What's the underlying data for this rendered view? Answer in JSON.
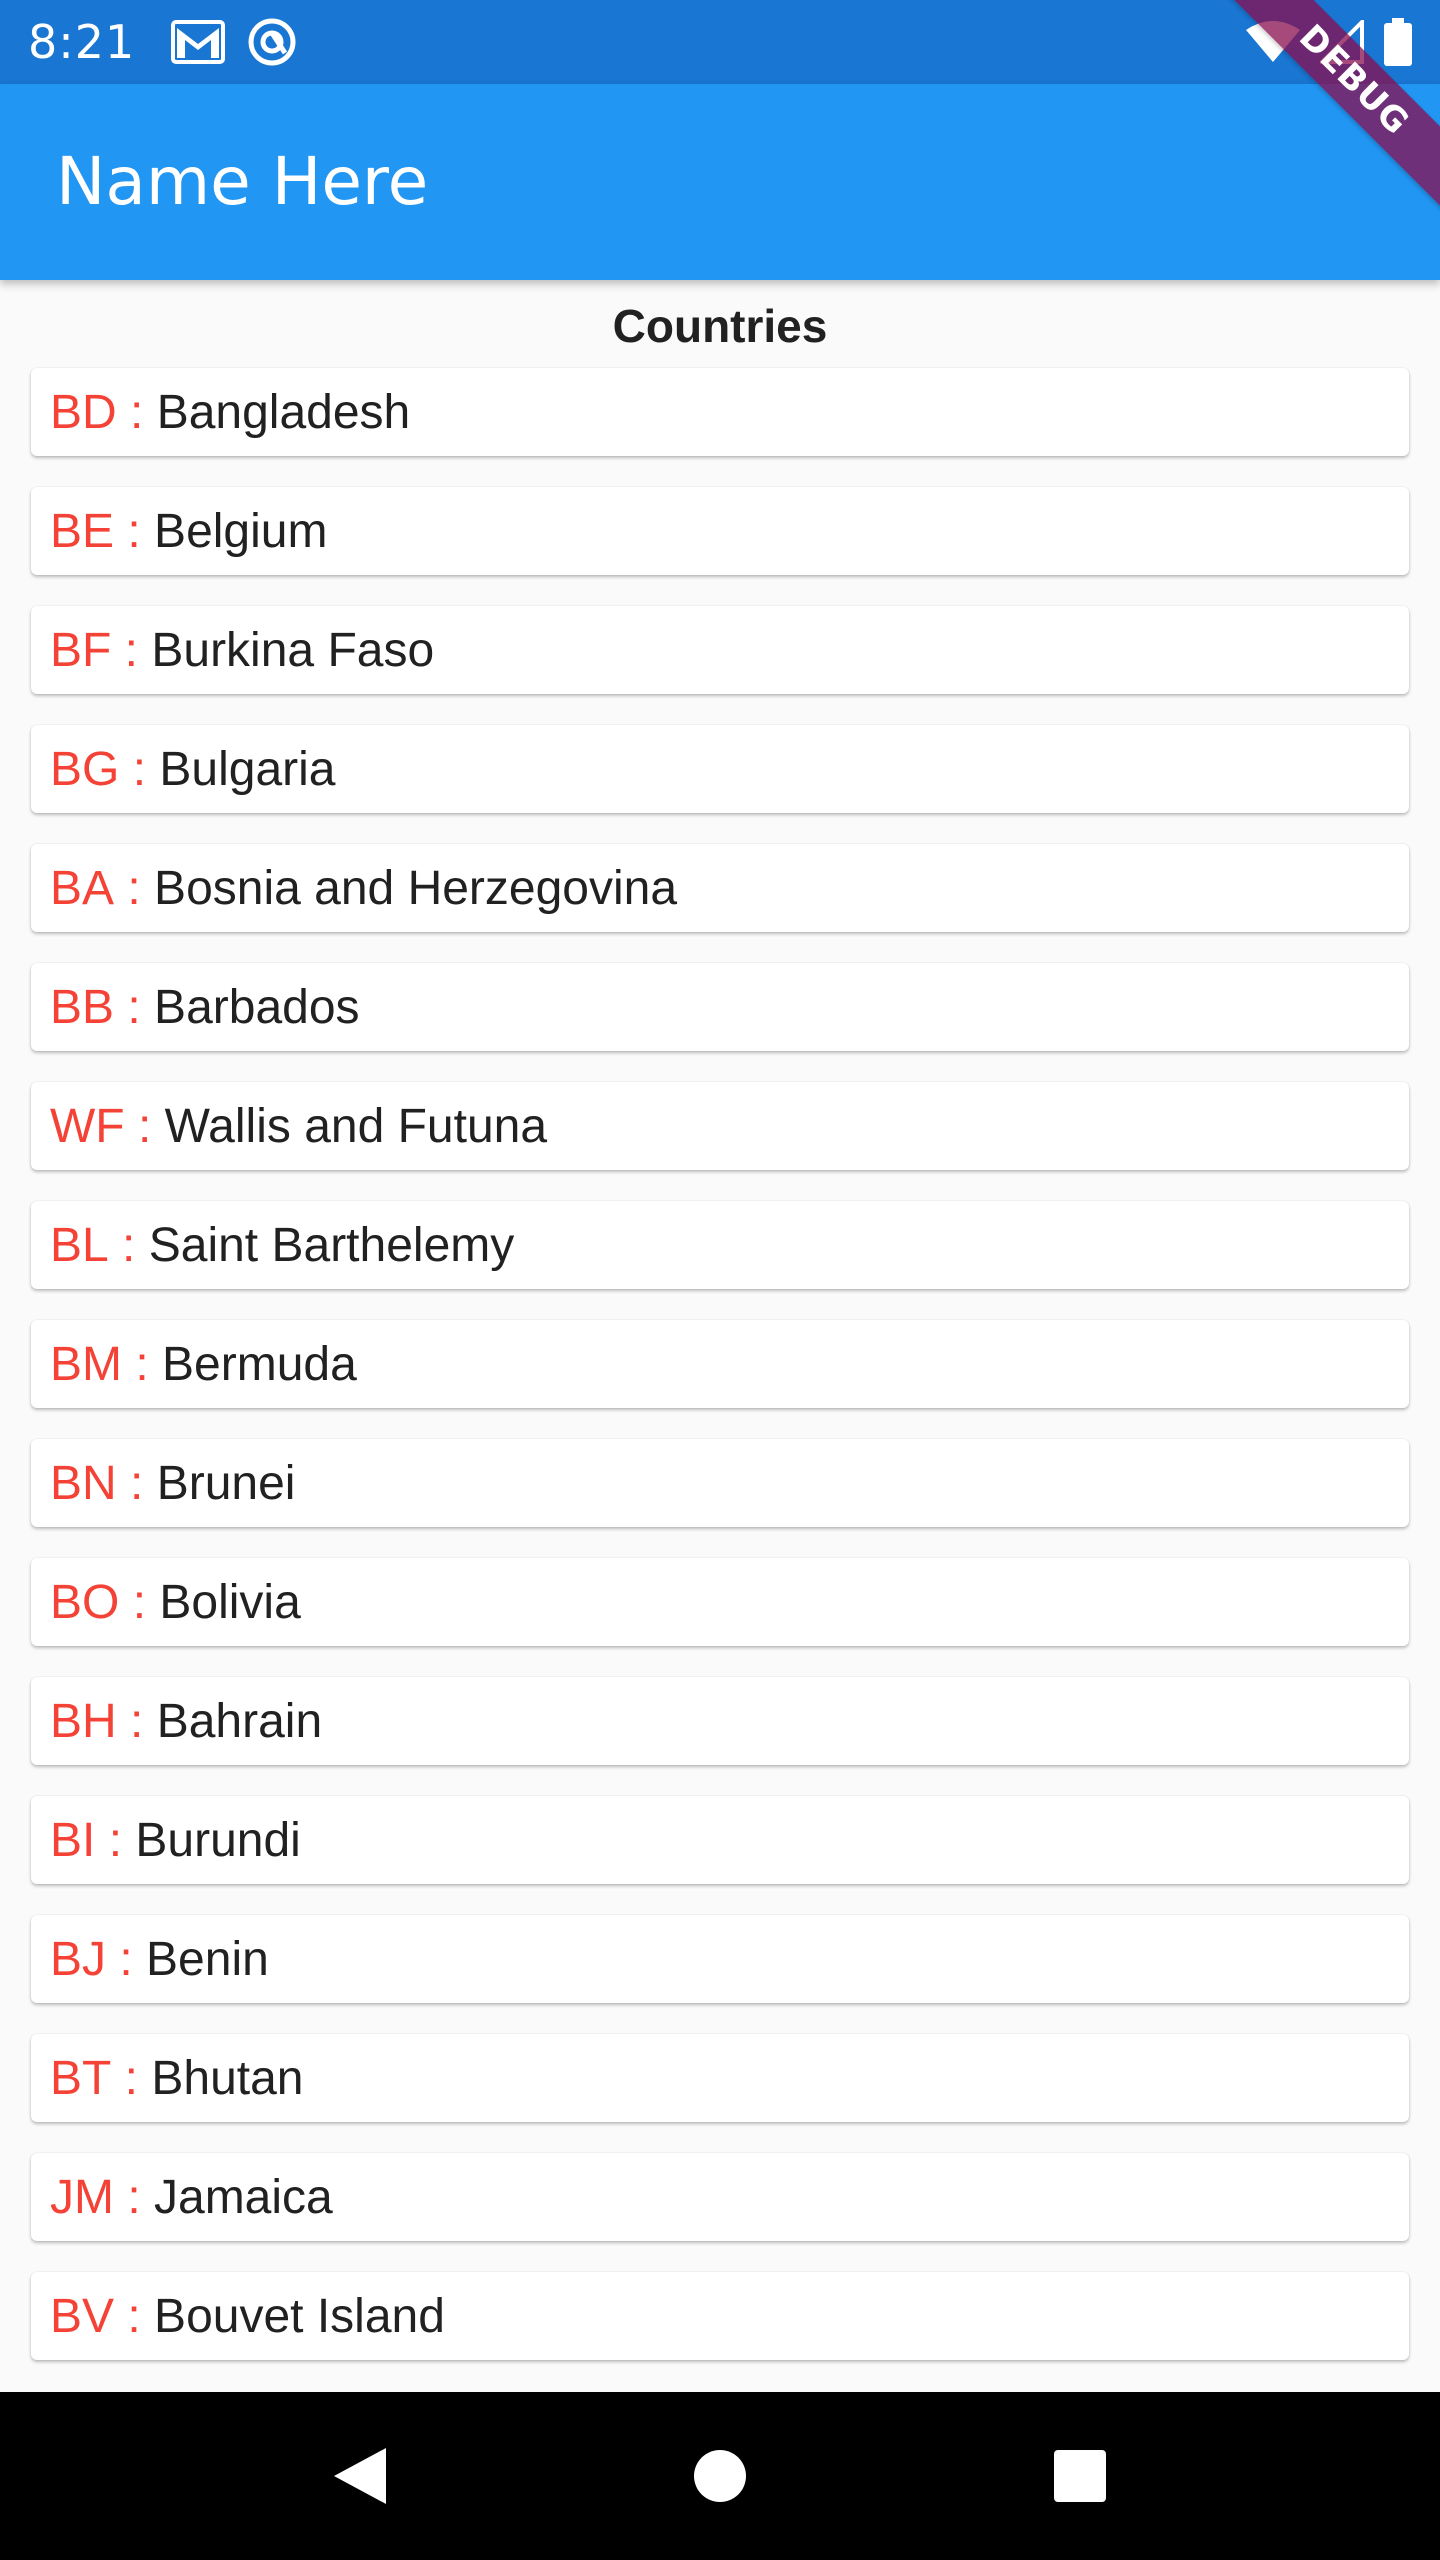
{
  "status_bar": {
    "time": "8:21",
    "icons_left": [
      "gmail-icon",
      "sync-icon"
    ],
    "icons_right": [
      "wifi-icon",
      "cell-signal-icon",
      "battery-icon"
    ]
  },
  "app_bar": {
    "title": "Name Here",
    "color": "#2196F3"
  },
  "debug_banner": {
    "label": "DEBUG"
  },
  "list": {
    "title": "Countries",
    "separator": " : ",
    "code_color": "#F44336",
    "items": [
      {
        "code": "BD",
        "name": "Bangladesh"
      },
      {
        "code": "BE",
        "name": "Belgium"
      },
      {
        "code": "BF",
        "name": "Burkina Faso"
      },
      {
        "code": "BG",
        "name": "Bulgaria"
      },
      {
        "code": "BA",
        "name": "Bosnia and Herzegovina"
      },
      {
        "code": "BB",
        "name": "Barbados"
      },
      {
        "code": "WF",
        "name": "Wallis and Futuna"
      },
      {
        "code": "BL",
        "name": "Saint Barthelemy"
      },
      {
        "code": "BM",
        "name": "Bermuda"
      },
      {
        "code": "BN",
        "name": "Brunei"
      },
      {
        "code": "BO",
        "name": "Bolivia"
      },
      {
        "code": "BH",
        "name": "Bahrain"
      },
      {
        "code": "BI",
        "name": "Burundi"
      },
      {
        "code": "BJ",
        "name": "Benin"
      },
      {
        "code": "BT",
        "name": "Bhutan"
      },
      {
        "code": "JM",
        "name": "Jamaica"
      },
      {
        "code": "BV",
        "name": "Bouvet Island"
      }
    ]
  },
  "nav_bar": {
    "buttons": [
      "back-icon",
      "home-icon",
      "recents-icon"
    ]
  }
}
